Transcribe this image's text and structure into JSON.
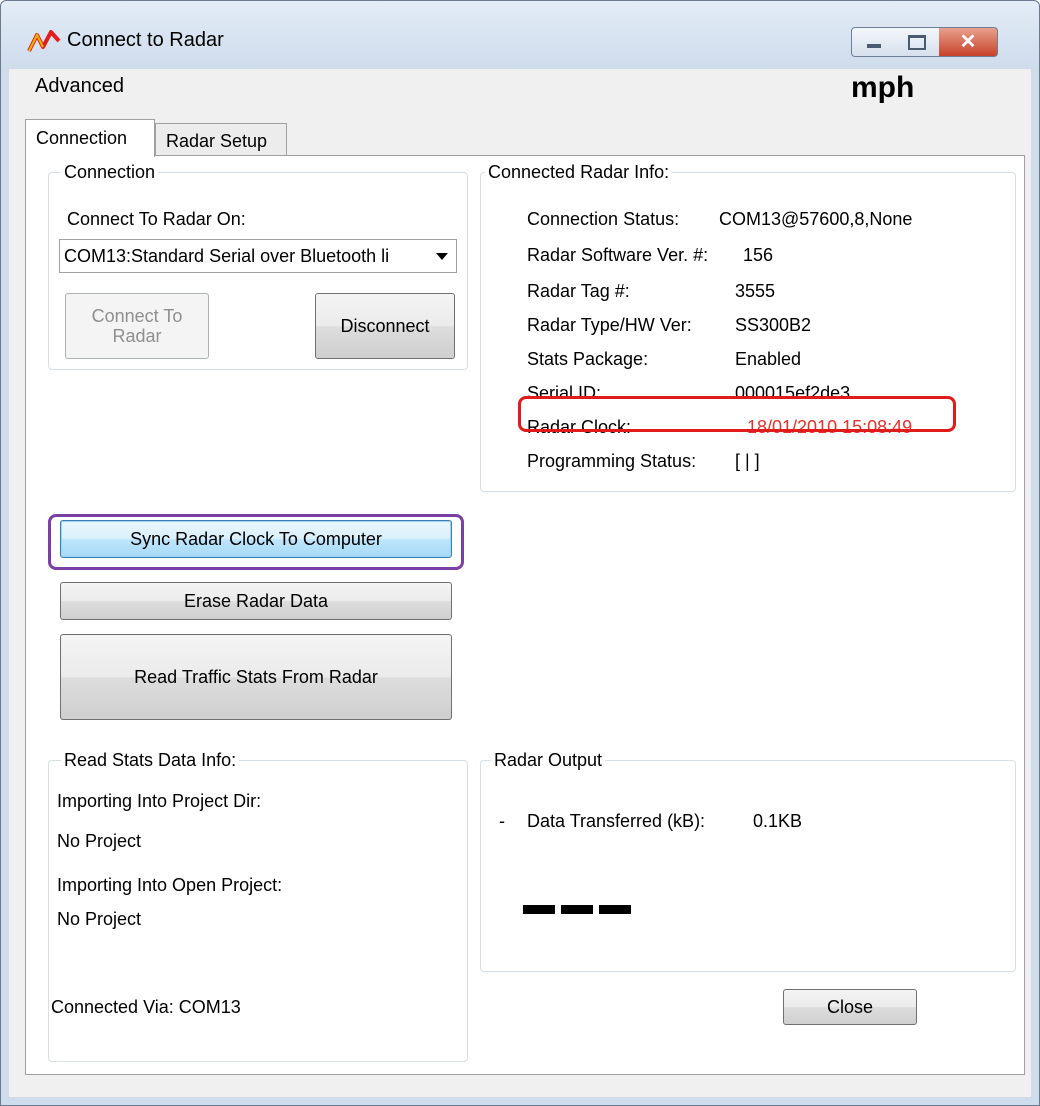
{
  "window": {
    "title": "Connect to Radar"
  },
  "menu": {
    "advanced": "Advanced",
    "units": "mph"
  },
  "tabs": [
    {
      "label": "Connection"
    },
    {
      "label": "Radar Setup"
    }
  ],
  "connection_group": {
    "legend": "Connection",
    "connect_on_label": "Connect To Radar On:",
    "port_selected": "COM13:Standard Serial over Bluetooth li",
    "connect_button": "Connect To Radar",
    "disconnect_button": "Disconnect"
  },
  "radar_info": {
    "legend": "Connected Radar Info:",
    "rows": [
      {
        "label": "Connection Status:",
        "value": "COM13@57600,8,None"
      },
      {
        "label": "Radar Software Ver. #:",
        "value": "156"
      },
      {
        "label": "Radar Tag #:",
        "value": "3555"
      },
      {
        "label": "Radar Type/HW Ver:",
        "value": "SS300B2"
      },
      {
        "label": "Stats Package:",
        "value": "Enabled"
      },
      {
        "label": "Serial ID:",
        "value": "000015ef2de3"
      },
      {
        "label": "Radar Clock:",
        "value": "18/01/2010 15:08:49"
      },
      {
        "label": "Programming Status:",
        "value": "[ | ]"
      }
    ]
  },
  "actions": {
    "sync_clock": "Sync Radar Clock To Computer",
    "erase_data": "Erase Radar Data",
    "read_stats": "Read Traffic Stats From Radar"
  },
  "stats_info": {
    "legend": "Read Stats Data Info:",
    "project_dir_label": "Importing Into Project Dir:",
    "project_dir_value": "No Project",
    "open_project_label": "Importing Into Open Project:",
    "open_project_value": "No Project"
  },
  "radar_output": {
    "legend": "Radar Output",
    "data_transferred_prefix": "-",
    "data_transferred_label": "Data Transferred (kB):",
    "data_transferred_value": "0.1KB"
  },
  "footer": {
    "connected_via": "Connected Via:  COM13",
    "close_button": "Close"
  },
  "colors": {
    "highlight_red": "#e01b1b",
    "highlight_purple": "#7b3fa6",
    "clock_text": "#e8302a"
  }
}
